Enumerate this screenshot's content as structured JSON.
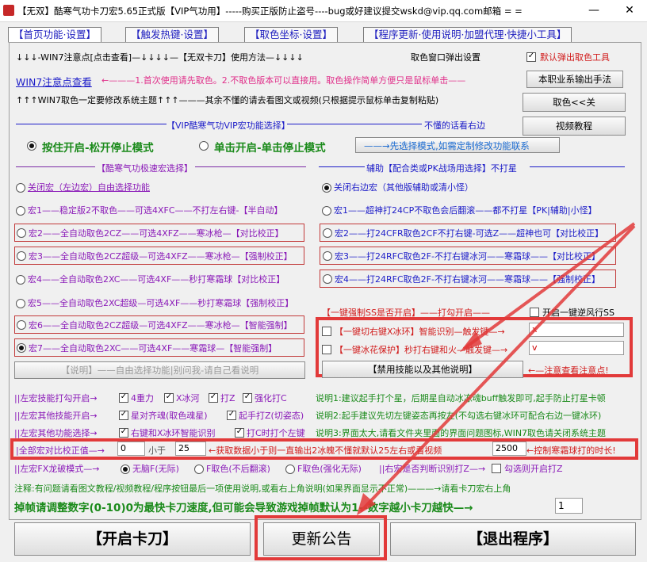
{
  "window": {
    "title": "【无双】酷寒气功卡刀宏5.65正式版【VIP气功用】-----购买正版防止盗号----bug或好建议提交wskd@vip.qq.com邮箱 = =",
    "minimize": "—",
    "close": "✕"
  },
  "tabs": [
    "【首页功能·设置】",
    "【触发热键·设置】",
    "【取色坐标·设置】",
    "【程序更新·使用说明·加盟代理·快捷小工具】"
  ],
  "top": {
    "row1_left": "↓↓↓-WIN7注意点[点击查看]—↓↓↓↓—【无双卡刀】使用方法—↓↓↓↓",
    "row1_right": "取色窗口弹出设置",
    "default_popup": "默认弹出取色工具",
    "win7_link": "WIN7注意点查看",
    "win7_note": "←———1.首次使用请先取色。2.不取色版本可以直接用。取色操作简单方便只是鼠标单击——",
    "btn_output": "本职业系输出手法",
    "row3": "↑↑↑WIN7取色一定要修改系统主题↑↑↑———其余不懂的请去看图文或视频(只根据提示鼠标单击复制粘贴)",
    "btn_color": "取色<<关",
    "vip_title": "【VIP酷寒气功VIP宏功能选择】",
    "vip_right": "不懂的话看右边",
    "btn_video": "视频教程",
    "mode1": "按住开启-松开停止模式",
    "mode2": "单击开启-单击停止模式",
    "mode_hint": "——→先选择模式,如需定制修改功能联系"
  },
  "left_col": {
    "title": "【酷寒气功极速宏选择】",
    "items": [
      "关闭宏（左边宏）自由选择功能",
      "宏1——稳定版2不取色——可选4XFC——不打左右键-【半自动】",
      "宏2——全自动取色2CZ——可选4XFZ——寒冰枪—【对比校正】",
      "宏3——全自动取色2CZ超级—可选4XFZ——寒冰枪—【强制校正】",
      "宏4——全自动取色2XC——可选4XF——秒打寒霜球【对比校正】",
      "宏5——全自动取色2XC超级—可选4XF——秒打寒霜球【强制校正】",
      "宏6——全自动取色2CZ超级—可选4XFZ——寒冰枪—【智能强制】",
      "宏7——全自动取色2XC——可选4XF——寒霜球—【智能强制】"
    ],
    "disabled_btn": "【说明】——自由选择功能|别问我-请自己看说明"
  },
  "right_col": {
    "title": "辅助【配合类或PK战场用选择】不打星",
    "items": [
      "关闭右边宏（其他版辅助或清小怪）",
      "宏1——超神打24CP不取色会后翻滚——都不打星【PK|辅助|小怪】",
      "宏2——打24CFR取色2CF不打右键-可选Z——超神也可【对比校正】",
      "宏3——打24RFC取色2F-不打右键冰河——寒霜球——【对比校正】",
      "宏4——打24RFC取色2F-不打右键冰河——寒霜球——【强制校正】"
    ],
    "oneclick_title": "【一键强制SS是否开启】——打勾开启——",
    "reverse_ss": "开启一键逆风行SS",
    "cut_label": "【一键切右键X冰环】智能识别—触发键—→",
    "cut_key": "x",
    "protect_label": "【一键冰花保护】秒打右键和火—触发键—→",
    "protect_key": "v",
    "ban_btn": "【禁用技能以及其他说明】",
    "ban_note": "←—注意查看注意点!"
  },
  "bottom": {
    "r1_label": "||左宏技能打勾开启→",
    "r1_opts": [
      "4重力",
      "X冰河",
      "打Z",
      "强化打C"
    ],
    "r1_info": "说明1:建议起手打个星，后期星自动冰冻魂buff触发即可,起手防止打星卡顿",
    "r2_label": "||左宏其他技能开启→",
    "r2_opts": [
      "星对齐魂(取色魂星)",
      "起手打Z(切姿态)"
    ],
    "r2_info": "说明2:起手建议先切左键姿态再按左(不勾选右键冰环可配合右边一键冰环)",
    "r3_label": "||左宏其他功能选择→",
    "r3_opts": [
      "右键和X冰环智能识别",
      "打C时打个左键"
    ],
    "r3_info": "说明3:界面太大,请看文件夹里面的界面问题图标,WIN7取色请关闭系统主题",
    "r4_label": "|全部宏对比校正值—→",
    "r4_val1": "0",
    "r4_less": "小于",
    "r4_val2": "25",
    "r4_hint": "←获取数据小于则一直输出2冰魄不懂就默认25左右或看视频",
    "r4_val3": "2500",
    "r4_hint2": "←控制寒霜球打的时长!",
    "r5_label": "||左宏FX龙破模式—→",
    "r5_opts": [
      "无脑F(无际)",
      "F取色(不后翻滚)",
      "F取色(强化无际)"
    ],
    "r5_right": "||右宏是否判断识别打Z—→",
    "r5_chk": "勾选则开启打Z",
    "note": "注释:有问题请看图文教程/视频教程/程序按钮最后一项使用说明,或看右上角说明(如果界面显示不正常)———→请看卡刀宏右上角",
    "drop_text": "掉帧请调整数字(0-10)0为最快卡刀速度,但可能会导致游戏掉帧默认为1--数字越小卡刀越快—→",
    "drop_val": "1"
  },
  "actions": {
    "start": "【开启卡刀】",
    "notice": "更新公告",
    "exit": "【退出程序】"
  }
}
